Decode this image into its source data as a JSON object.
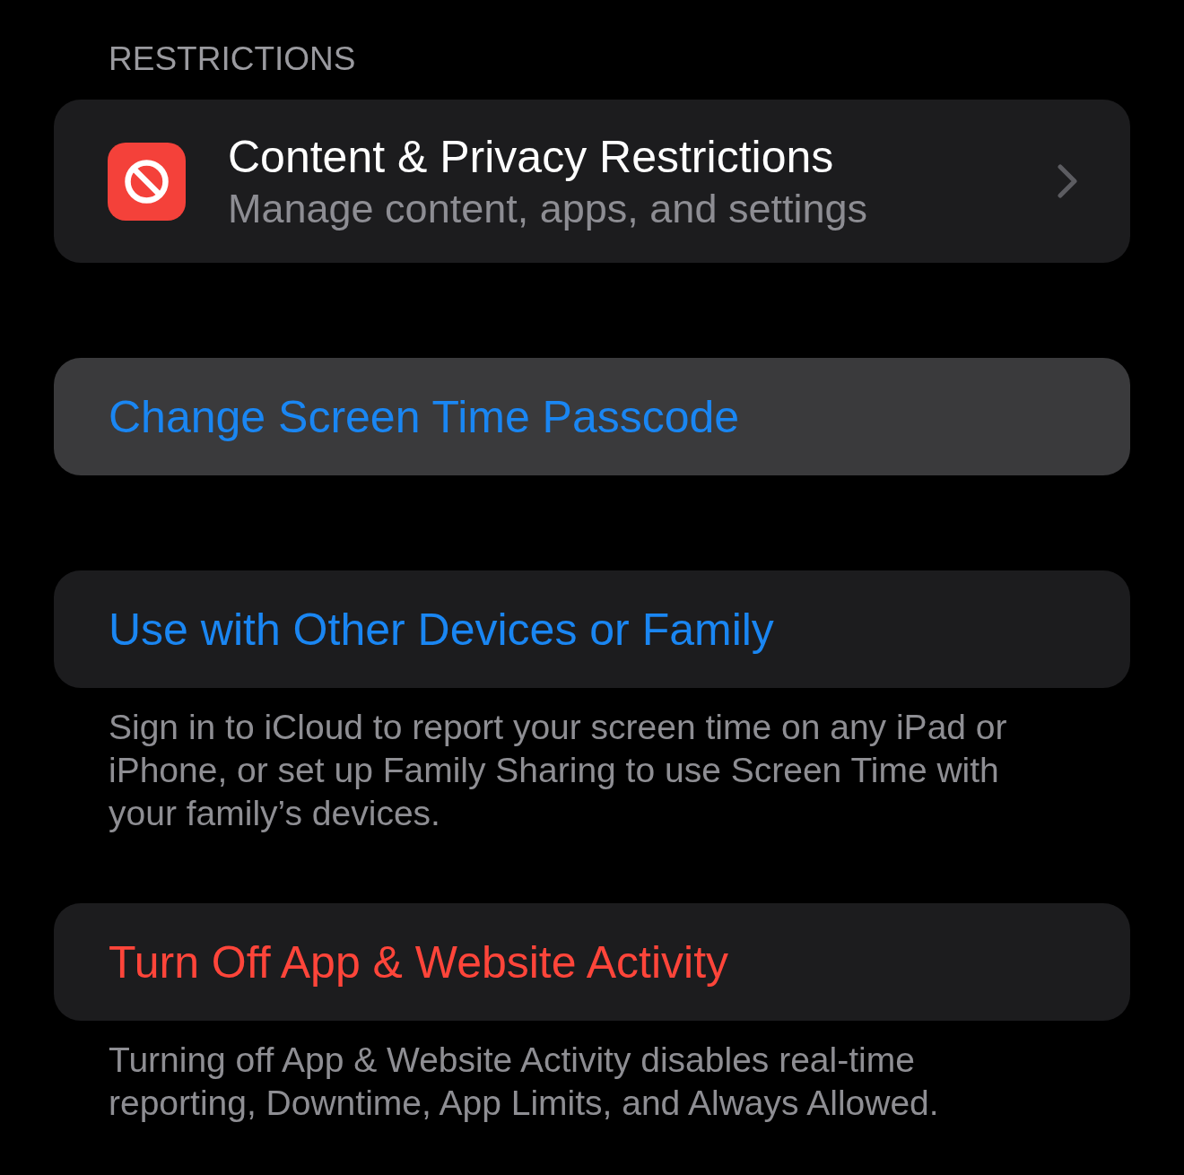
{
  "sections": [
    {
      "header": "RESTRICTIONS",
      "rows": [
        {
          "kind": "navigation",
          "title": "Content & Privacy Restrictions",
          "subtitle": "Manage content, apps, and settings",
          "highlighted": false
        }
      ]
    },
    {
      "rows": [
        {
          "kind": "action",
          "title": "Change Screen Time Passcode",
          "highlighted": true
        }
      ]
    },
    {
      "rows": [
        {
          "kind": "action",
          "title": "Use with Other Devices or Family",
          "highlighted": false
        }
      ],
      "footer": "Sign in to iCloud to report your screen time on any iPad or iPhone, or set up Family Sharing to use Screen Time with your family’s devices."
    },
    {
      "rows": [
        {
          "kind": "destructive",
          "title": "Turn Off App & Website Activity",
          "highlighted": false
        }
      ],
      "footer": "Turning off App & Website Activity disables real-time reporting, Downtime, App Limits, and Always Allowed."
    }
  ]
}
